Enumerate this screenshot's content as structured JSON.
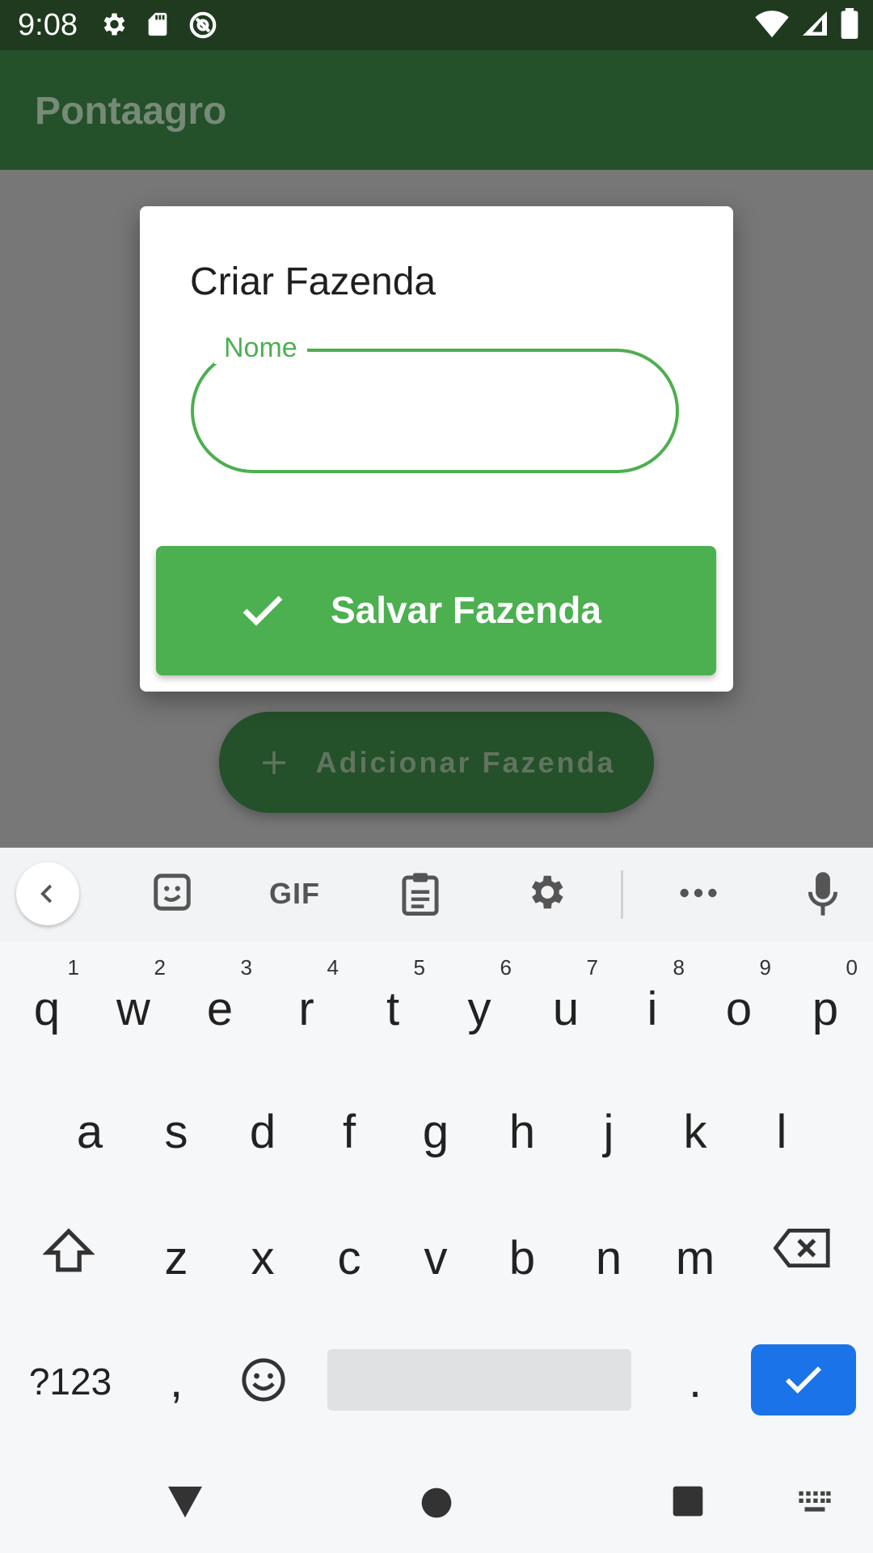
{
  "status_bar": {
    "time": "9:08"
  },
  "app_bar": {
    "title": "Pontaagro"
  },
  "fab": {
    "label": "Adicionar Fazenda"
  },
  "dialog": {
    "title": "Criar Fazenda",
    "field": {
      "label": "Nome",
      "value": ""
    },
    "save_button": {
      "label": "Salvar Fazenda"
    }
  },
  "keyboard": {
    "toolbar": {
      "gif_label": "GIF"
    },
    "row1": [
      {
        "key": "q",
        "hint": "1"
      },
      {
        "key": "w",
        "hint": "2"
      },
      {
        "key": "e",
        "hint": "3"
      },
      {
        "key": "r",
        "hint": "4"
      },
      {
        "key": "t",
        "hint": "5"
      },
      {
        "key": "y",
        "hint": "6"
      },
      {
        "key": "u",
        "hint": "7"
      },
      {
        "key": "i",
        "hint": "8"
      },
      {
        "key": "o",
        "hint": "9"
      },
      {
        "key": "p",
        "hint": "0"
      }
    ],
    "row2": [
      "a",
      "s",
      "d",
      "f",
      "g",
      "h",
      "j",
      "k",
      "l"
    ],
    "row3": [
      "z",
      "x",
      "c",
      "v",
      "b",
      "n",
      "m"
    ],
    "symbols_label": "?123",
    "comma": ",",
    "period": "."
  },
  "colors": {
    "accent": "#4caf50",
    "app_bar": "#24502a",
    "enter_key": "#1a73e8"
  }
}
